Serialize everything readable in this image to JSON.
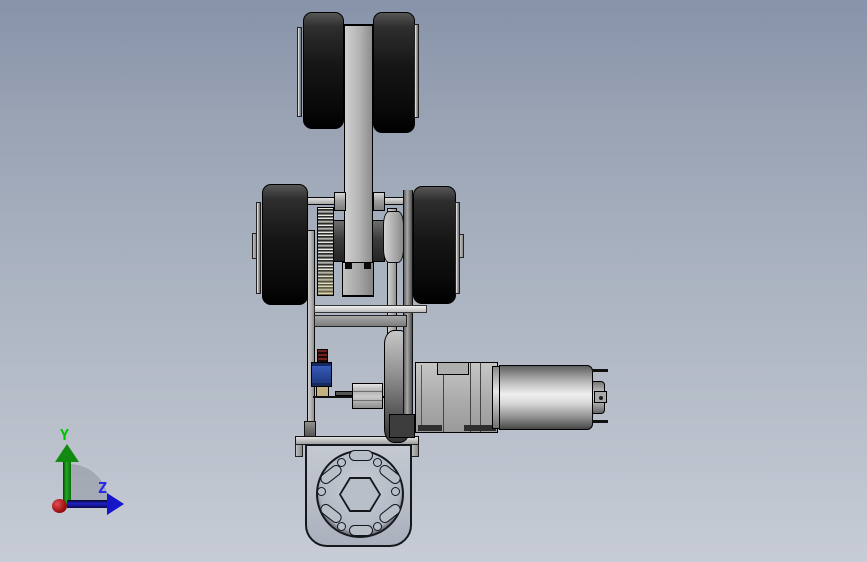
{
  "viewport": {
    "kind": "cad-3d-viewport",
    "background_gradient": [
      "#8793a9",
      "#a8b1bf",
      "#c7ccd6"
    ]
  },
  "triad": {
    "y_label": "Y",
    "z_label": "Z",
    "y_color": "#00c400",
    "z_color": "#2424ee",
    "x_color": "#b81414"
  },
  "scene": {
    "part_colors": {
      "roller_rubber": "#141414",
      "frame_metal": "#b5b5b5",
      "servo_body_blue": "#2a4fa5",
      "servo_connector_red": "#6e2222",
      "servo_horn_tan": "#c3b27f",
      "belt_gray": "#8a8a8a",
      "motor_silver": "#c9c9c9",
      "terminal_black": "#111111"
    },
    "parts": [
      "top-roller-left",
      "top-roller-right",
      "swing-arm",
      "arm-fork",
      "mid-roller-left",
      "mid-roller-right",
      "spur-gear",
      "axle-rod",
      "hex-nut-left",
      "hex-nut-right",
      "center-axle",
      "belt-pulley",
      "drive-belt",
      "frame-bar-left",
      "frame-bar-right",
      "cross-rail-upper",
      "cross-rail-lower",
      "micro-servo",
      "servo-wire",
      "hex-standoff",
      "output-disc",
      "gearbox",
      "dc-motor",
      "motor-terminal-top",
      "motor-terminal-bottom",
      "motor-terminal-tab",
      "mount-bracket",
      "bearing-flange",
      "flange-hexagon"
    ]
  }
}
